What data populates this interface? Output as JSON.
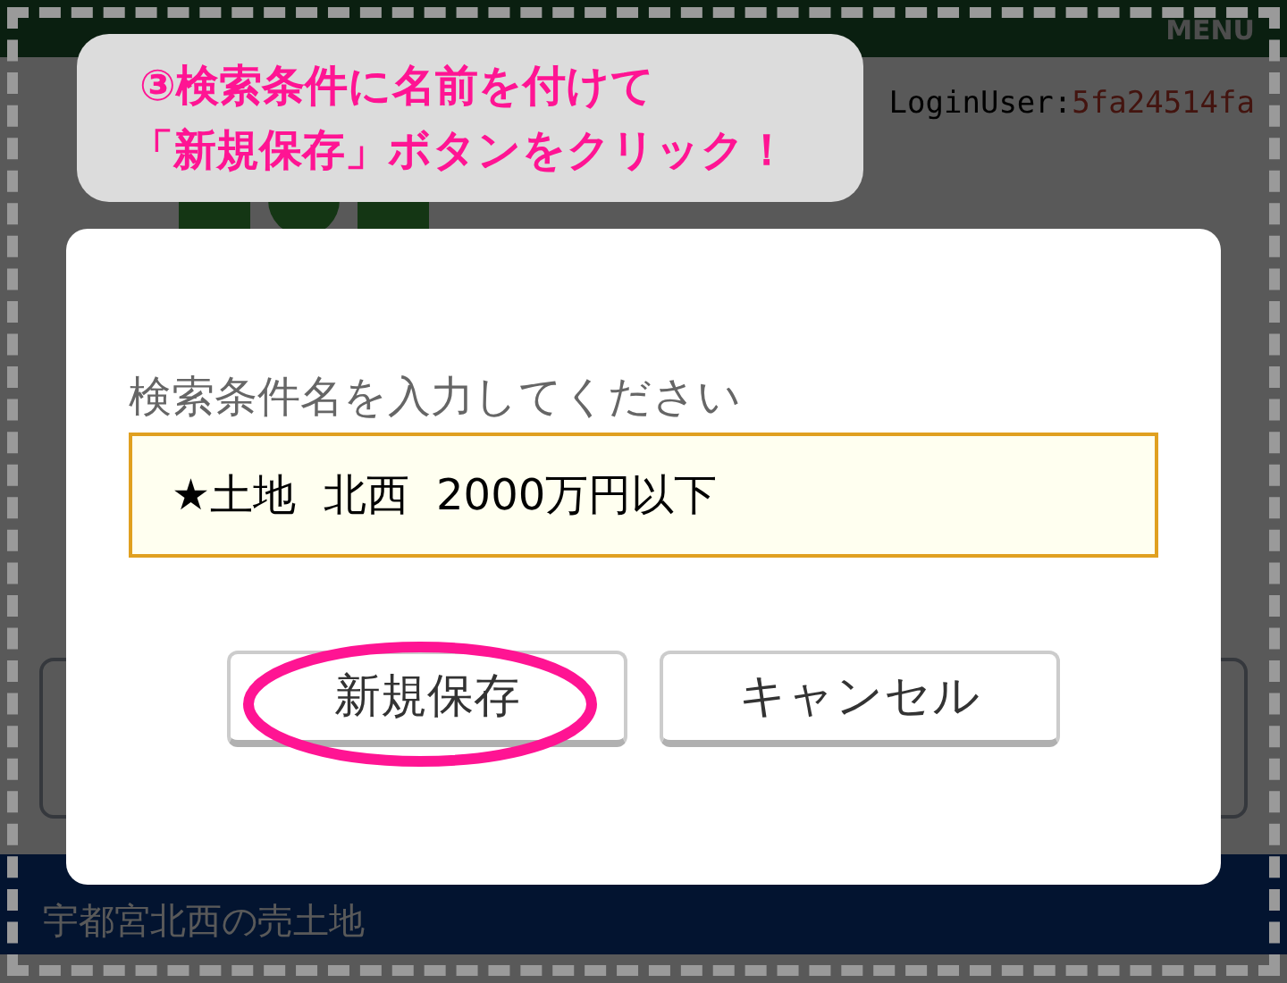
{
  "header": {
    "menu": "MENU",
    "login_label": "LoginUser:",
    "login_user": "5fa24514fa"
  },
  "section_title": "宇都宮北西の売土地",
  "annotation": {
    "lines": [
      "③検索条件に名前を付けて",
      "「新規保存」ボタンをクリック！"
    ]
  },
  "dialog": {
    "label": "検索条件名を入力してください",
    "field": {
      "value": "★土地  北西  2000万円以下"
    },
    "buttons": [
      {
        "label": "新規保存",
        "highlighted": true
      },
      {
        "label": "キャンセル",
        "highlighted": false
      }
    ]
  }
}
